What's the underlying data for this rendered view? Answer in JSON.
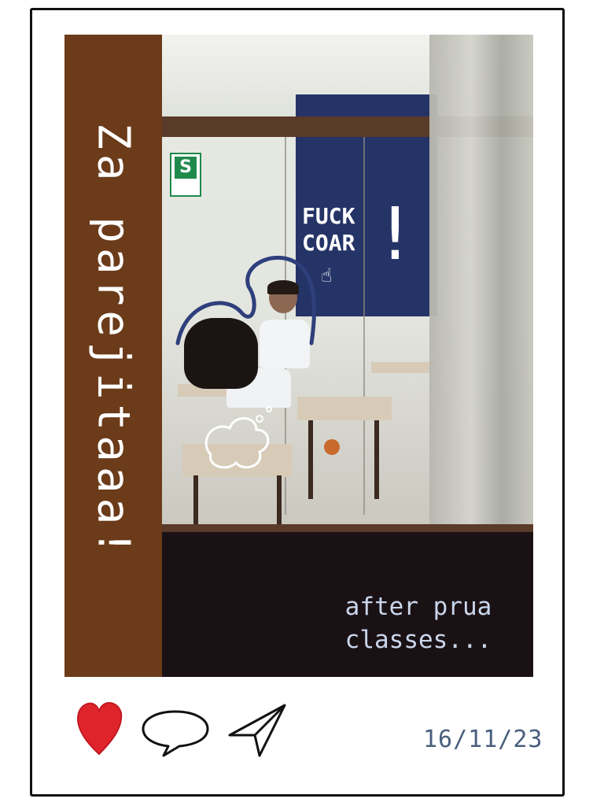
{
  "photo": {
    "strip_text": "Za parejitaaa!",
    "board_text_line1": "FUCK",
    "board_text_line2": "COAR",
    "board_excl": "!",
    "caption_line1": "after prua",
    "caption_line2": "classes...",
    "exit_letter": "S"
  },
  "actions": {
    "like_icon": "heart-icon",
    "comment_icon": "speech-bubble-icon",
    "share_icon": "paper-plane-icon"
  },
  "footer": {
    "date": "16/11/23"
  },
  "colors": {
    "strip": "#6b3b1a",
    "heart": "#e0242c",
    "date": "#4a5f7e",
    "caption": "#c9d6ec"
  }
}
